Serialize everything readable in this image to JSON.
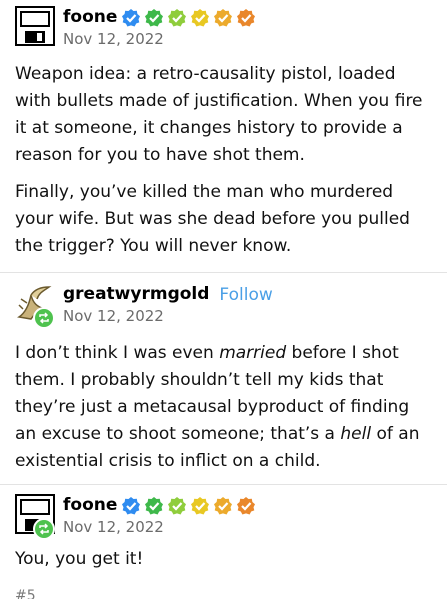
{
  "posts": [
    {
      "username": "foone",
      "date": "Nov 12, 2022",
      "badges": [
        "#2f8cf0",
        "#3eb84a",
        "#8fcd3c",
        "#e8c823",
        "#ecaa2c",
        "#e9872b"
      ],
      "paragraphs": [
        "Weapon idea: a retro-causality pistol, loaded with bullets made of justification. When you fire it at someone, it changes history to provide a reason for you to have shot them.",
        "Finally, you’ve killed the man who murdered your wife. But was she dead before you pulled the trigger? You will never know."
      ]
    },
    {
      "username": "greatwyrmgold",
      "follow_label": "Follow",
      "date": "Nov 12, 2022",
      "paragraph_parts": [
        "I don’t think I was even ",
        "married",
        " before I shot them. I probably shouldn’t tell my kids that they’re just a metacausal byproduct of finding an excuse to shoot someone; that’s a ",
        "hell",
        " of an existential crisis to inflict on a child."
      ]
    },
    {
      "username": "foone",
      "date": "Nov 12, 2022",
      "badges": [
        "#2f8cf0",
        "#3eb84a",
        "#8fcd3c",
        "#e8c823",
        "#ecaa2c",
        "#e9872b"
      ],
      "paragraphs": [
        "You, you get it!"
      ]
    }
  ],
  "partial_tag": "#5"
}
